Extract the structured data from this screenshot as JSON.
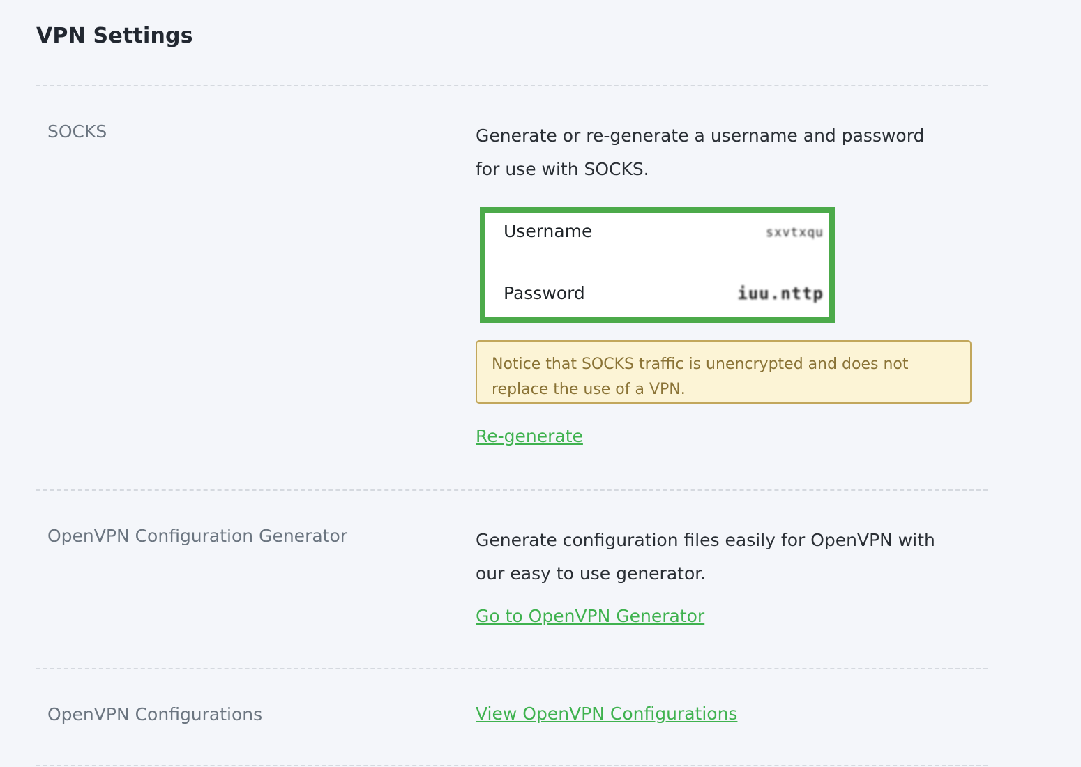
{
  "page": {
    "title": "VPN Settings"
  },
  "socks": {
    "label": "SOCKS",
    "description_line1": "Generate or re-generate a username and password",
    "description_line2": "for use with SOCKS.",
    "username_label": "Username",
    "username_value": "sxvtxqu",
    "password_label": "Password",
    "password_value": "iuu.nttp",
    "notice_line1": "Notice that SOCKS traffic is unencrypted and does not",
    "notice_line2": "replace the use of a VPN.",
    "regenerate_link": "Re-generate"
  },
  "openvpn_generator": {
    "label": "OpenVPN Configuration Generator",
    "description_line1": "Generate configuration files easily for OpenVPN with",
    "description_line2": "our easy to use generator.",
    "link": "Go to OpenVPN Generator"
  },
  "openvpn_configs": {
    "label": "OpenVPN Configurations",
    "link": "View OpenVPN Configurations"
  },
  "colors": {
    "accent_green": "#3fb24f",
    "highlight_border": "#4caa4a",
    "notice_bg": "#fcf4d6",
    "notice_border": "#c2a75c",
    "notice_text": "#8a7336",
    "page_bg": "#f4f6fa"
  }
}
